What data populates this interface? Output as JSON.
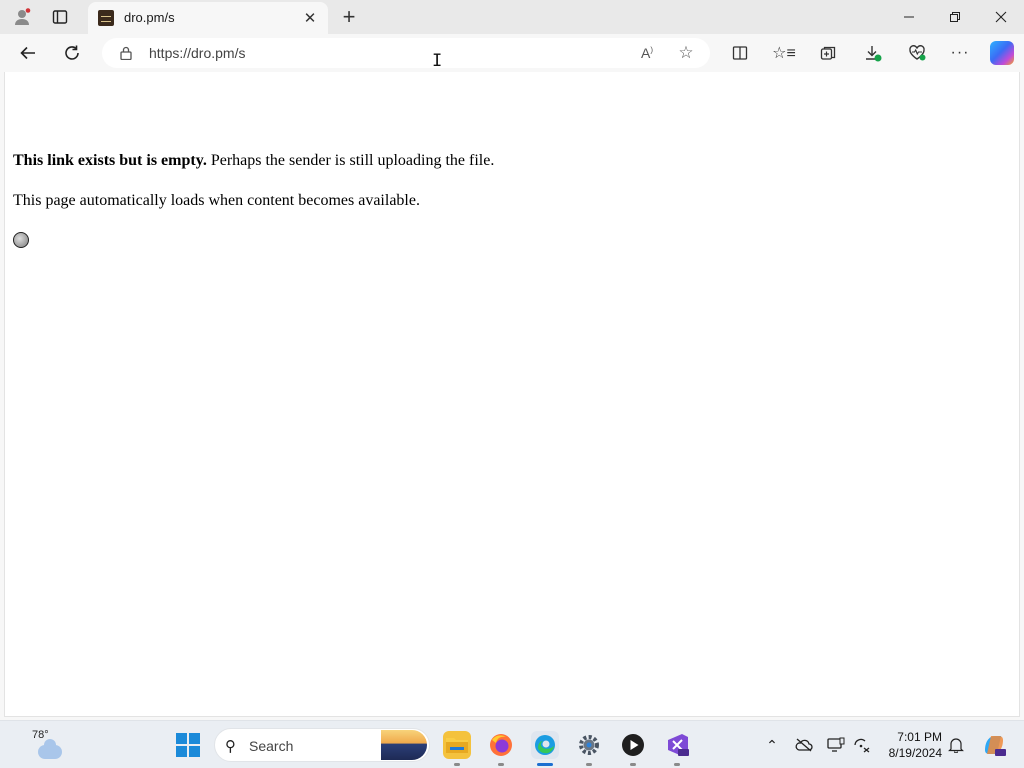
{
  "tab": {
    "title": "dro.pm/s"
  },
  "address": {
    "url": "https://dro.pm/s"
  },
  "page": {
    "line1_bold": "This link exists but is empty.",
    "line1_rest": " Perhaps the sender is still uploading the file.",
    "line2": "This page automatically loads when content becomes available."
  },
  "taskbar": {
    "weather_temp": "78°",
    "search_label": "Search",
    "time": "7:01 PM",
    "date": "8/19/2024"
  },
  "colors": {
    "accent": "#1b6fd0",
    "content_bg": "#ffffff",
    "chrome_bg": "#f7f7f7"
  }
}
